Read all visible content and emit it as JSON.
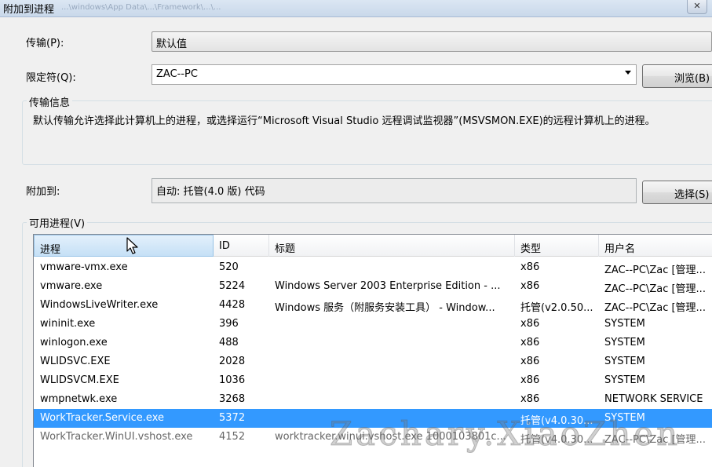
{
  "window": {
    "title": "附加到进程",
    "path_hint": "...\\windows\\App Data\\...\\Framework\\...\\..."
  },
  "transport": {
    "label": "传输(P):",
    "value": "默认值"
  },
  "qualifier": {
    "label": "限定符(Q):",
    "value": "ZAC--PC",
    "browse_label": "浏览(B)"
  },
  "transport_info": {
    "title": "传输信息",
    "text": "默认传输允许选择此计算机上的进程，或选择运行“Microsoft Visual Studio 远程调试监视器”(MSVSMON.EXE)的远程计算机上的进程。"
  },
  "attach_to": {
    "label": "附加到:",
    "value": "自动: 托管(4.0 版) 代码",
    "select_label": "选择(S)"
  },
  "available_processes": {
    "title": "可用进程(V)",
    "columns": [
      "进程",
      "ID",
      "标题",
      "类型",
      "用户名"
    ],
    "rows": [
      {
        "process": "vmware-vmx.exe",
        "id": "520",
        "title": "",
        "type": "x86",
        "user": "ZAC--PC\\Zac [管理..."
      },
      {
        "process": "vmware.exe",
        "id": "5224",
        "title": "Windows Server 2003 Enterprise Edition - ...",
        "type": "x86",
        "user": "ZAC--PC\\Zac [管理..."
      },
      {
        "process": "WindowsLiveWriter.exe",
        "id": "4428",
        "title": "Windows 服务（附服务安装工具） - Window...",
        "type": "托管(v2.0.50...",
        "user": "ZAC--PC\\Zac [管理..."
      },
      {
        "process": "wininit.exe",
        "id": "396",
        "title": "",
        "type": "x86",
        "user": "SYSTEM"
      },
      {
        "process": "winlogon.exe",
        "id": "488",
        "title": "",
        "type": "x86",
        "user": "SYSTEM"
      },
      {
        "process": "WLIDSVC.EXE",
        "id": "2028",
        "title": "",
        "type": "x86",
        "user": "SYSTEM"
      },
      {
        "process": "WLIDSVCM.EXE",
        "id": "1036",
        "title": "",
        "type": "x86",
        "user": "SYSTEM"
      },
      {
        "process": "wmpnetwk.exe",
        "id": "3268",
        "title": "",
        "type": "x86",
        "user": "NETWORK SERVICE"
      },
      {
        "process": "WorkTracker.Service.exe",
        "id": "5372",
        "title": "",
        "type": "托管(v4.0.30...",
        "user": "SYSTEM"
      },
      {
        "process": "WorkTracker.WinUI.vshost.exe",
        "id": "4152",
        "title": "worktracker.winui.vshost.exe 1000103801c...",
        "type": "托管(v4.0.30...",
        "user": "ZAC--PC\\Zac [管理..."
      }
    ]
  },
  "watermark": "Zachary.XiaoZhen",
  "icons": {
    "close": "close-icon",
    "dropdown": "chevron-down-icon",
    "cursor": "mouse-cursor-icon"
  }
}
